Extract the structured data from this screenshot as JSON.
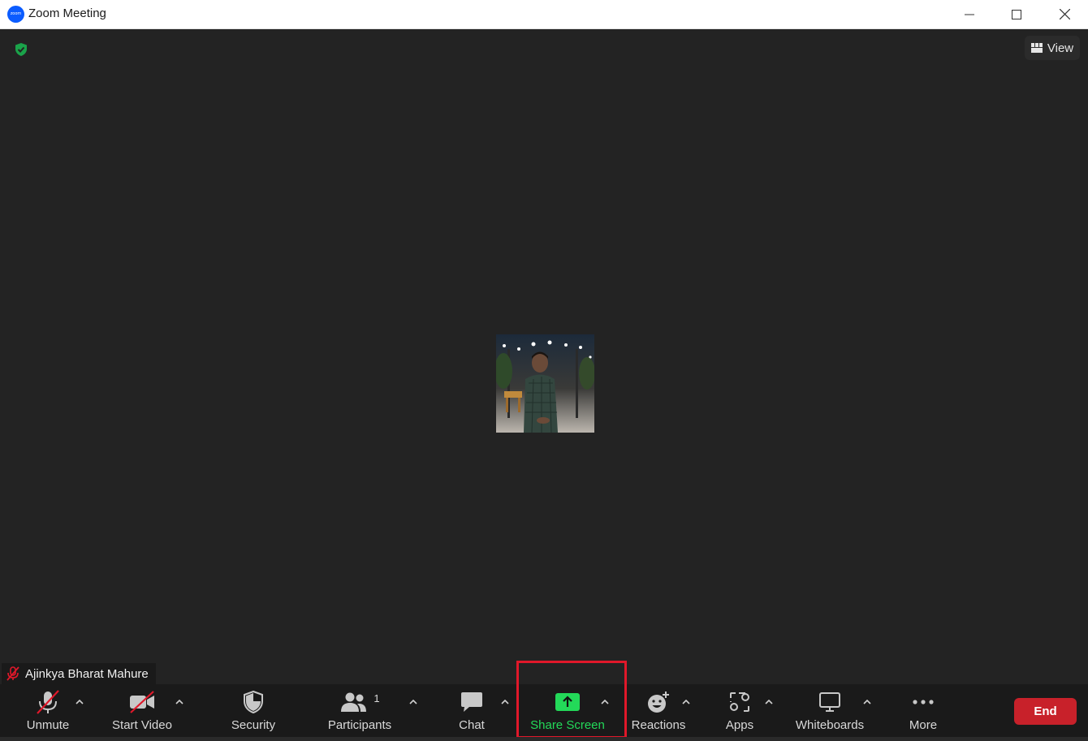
{
  "window": {
    "title": "Zoom Meeting",
    "logo_text": "zoom"
  },
  "meeting": {
    "view_label": "View",
    "participant_name": "Ajinkya Bharat Mahure"
  },
  "toolbar": {
    "unmute_label": "Unmute",
    "start_video_label": "Start Video",
    "security_label": "Security",
    "participants_label": "Participants",
    "participants_count": "1",
    "chat_label": "Chat",
    "share_screen_label": "Share Screen",
    "reactions_label": "Reactions",
    "apps_label": "Apps",
    "whiteboards_label": "Whiteboards",
    "more_label": "More",
    "end_label": "End"
  },
  "colors": {
    "share_green": "#23d959",
    "end_red": "#c8212a",
    "highlight_red": "#e0182a",
    "shield_green": "#1aa34a"
  }
}
